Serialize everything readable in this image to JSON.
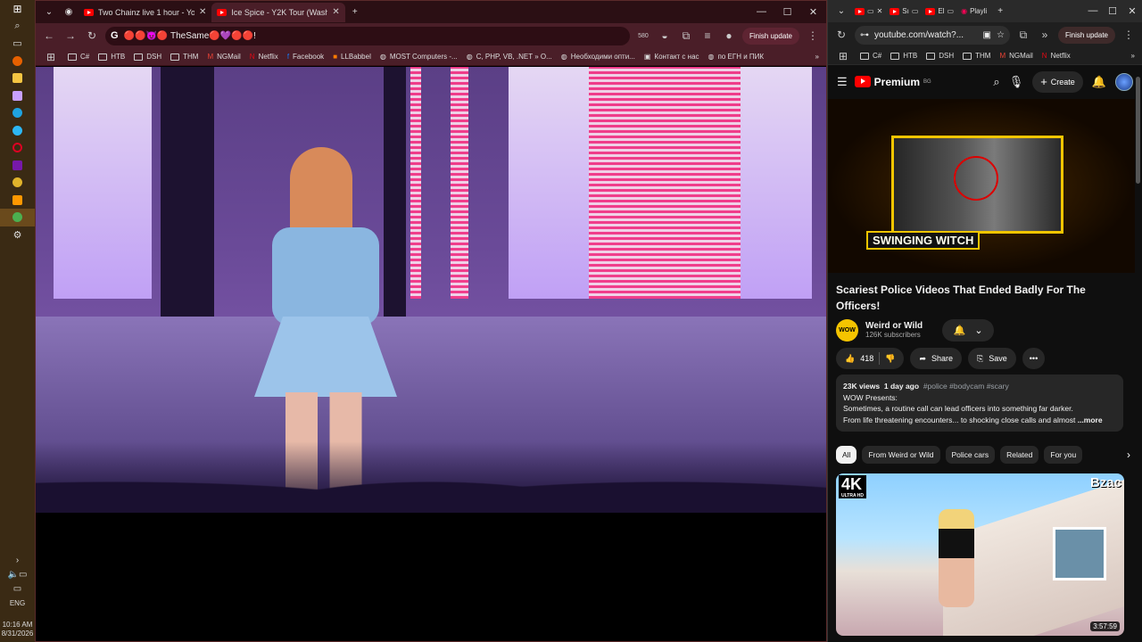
{
  "taskbar": {
    "time": "10:16 AM",
    "date": "8/31/2026",
    "lang": "ENG"
  },
  "win1": {
    "tabs": [
      {
        "title": "Two Chainz live 1 hour - Yo"
      },
      {
        "title": "Ice Spice - Y2K Tour (Washi"
      }
    ],
    "new_tab": "+",
    "omnibox_text": "🔴🔴😈🔴 TheSame🔴💜🔴🔴!",
    "extension_badge": "580",
    "finish_update": "Finish update",
    "bookmarks": [
      "C#",
      "HTB",
      "DSH",
      "THM",
      "NGMail",
      "Netflix",
      "Facebook",
      "LLBabbel",
      "MOST Computers -...",
      "C, PHP, VB, .NET » O...",
      "Необходими опти...",
      "Контакт с нас",
      "по ЕГН и ПИК"
    ]
  },
  "win2": {
    "url": "youtube.com/watch?...",
    "finish_update": "Finish update",
    "mini_tabs": [
      "Sı",
      "El",
      "Playli"
    ],
    "bookmarks": [
      "C#",
      "HTB",
      "DSH",
      "THM",
      "NGMail",
      "Netflix"
    ],
    "yt": {
      "brand": "Premium",
      "region": "BG",
      "create_label": "Create",
      "overlay_caption": "SWINGING WITCH",
      "video_title": "Scariest Police Videos That Ended Badly For The Officers!",
      "channel_name": "Weird or Wild",
      "channel_logo": "WOW",
      "subscribers": "126K subscribers",
      "likes": "418",
      "share": "Share",
      "save": "Save",
      "desc_views": "23K views",
      "desc_age": "1 day ago",
      "desc_tags": "#police #bodycam #scary",
      "desc_line1": "WOW Presents:",
      "desc_line2": "Sometimes, a routine call can lead officers into something far darker.",
      "desc_line3": "From life threatening encounters... to shocking close calls and almost",
      "desc_more": "...more",
      "chips": [
        "All",
        "From Weird or Wild",
        "Police cars",
        "Related",
        "For you"
      ],
      "thumb_badge_4k": "4K",
      "thumb_badge_4k_sub": "ULTRA HD",
      "thumb_brand": "Bzac",
      "thumb_duration": "3:57:59"
    }
  },
  "colors": {
    "youtube_red": "#ff0000",
    "tab_bg": "#2b0f14",
    "toolbar_bg": "#4a1e28",
    "caption_border": "#f2c500"
  }
}
